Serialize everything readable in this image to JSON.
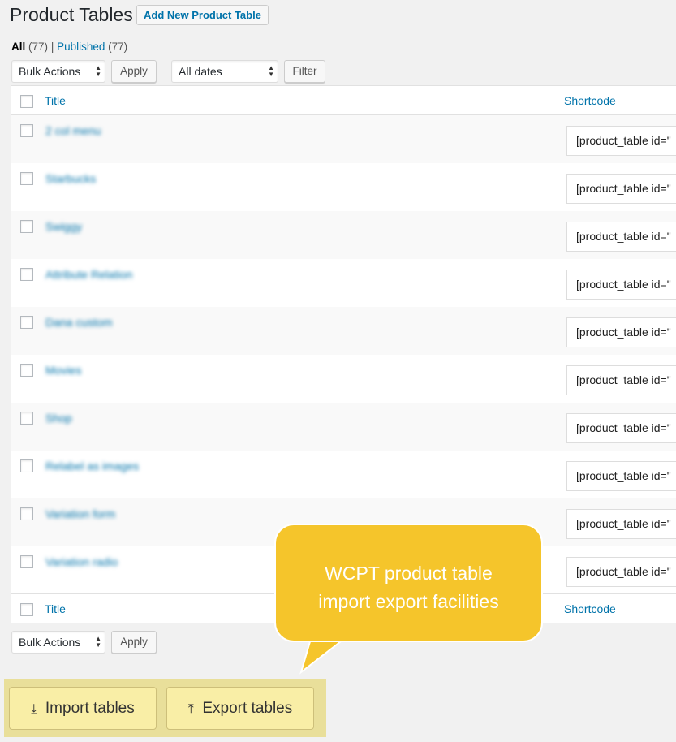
{
  "header": {
    "title": "Product Tables",
    "add_new": "Add New Product Table"
  },
  "filters": {
    "all_label": "All",
    "all_count": "(77)",
    "sep": "|",
    "published_label": "Published",
    "published_count": "(77)"
  },
  "actions": {
    "bulk": "Bulk Actions",
    "apply": "Apply",
    "dates": "All dates",
    "filter": "Filter"
  },
  "table": {
    "col_title": "Title",
    "col_shortcode": "Shortcode",
    "rows": [
      {
        "title": "2 col menu",
        "shortcode": "[product_table id=\""
      },
      {
        "title": "Starbucks",
        "shortcode": "[product_table id=\""
      },
      {
        "title": "Swiggy",
        "shortcode": "[product_table id=\""
      },
      {
        "title": "Attribute Relation",
        "shortcode": "[product_table id=\""
      },
      {
        "title": "Dana custom",
        "shortcode": "[product_table id=\""
      },
      {
        "title": "Movies",
        "shortcode": "[product_table id=\""
      },
      {
        "title": "Shop",
        "shortcode": "[product_table id=\""
      },
      {
        "title": "Relabel as images",
        "shortcode": "[product_table id=\""
      },
      {
        "title": "Variation form",
        "shortcode": "[product_table id=\""
      },
      {
        "title": "Variation radio",
        "shortcode": "[product_table id=\""
      }
    ]
  },
  "callout": {
    "line1": "WCPT product table",
    "line2": "import export facilities"
  },
  "io": {
    "import": "Import tables",
    "export": "Export tables"
  }
}
